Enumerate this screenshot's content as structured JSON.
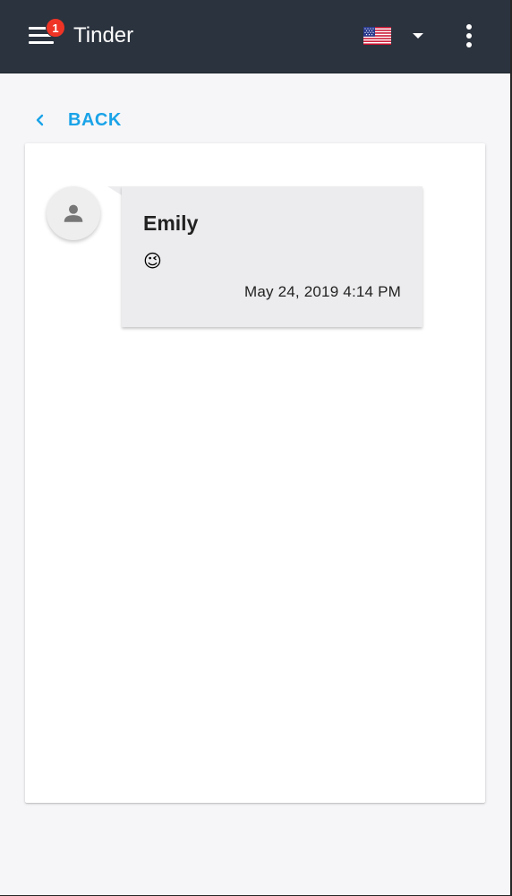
{
  "header": {
    "title": "Tinder",
    "notification_count": "1",
    "menu_icon": "hamburger-menu-icon",
    "language_flag": "us-flag-icon",
    "more_icon": "more-vert-icon"
  },
  "navigation": {
    "back_label": "BACK"
  },
  "message": {
    "sender": "Emily",
    "text": "😉",
    "timestamp": "May 24, 2019 4:14 PM",
    "avatar_icon": "person-icon"
  },
  "colors": {
    "appbar": "#2b333e",
    "accent": "#1aa3e8",
    "badge": "#ef3426",
    "bubble": "#ececee",
    "background": "#f6f6f8"
  }
}
